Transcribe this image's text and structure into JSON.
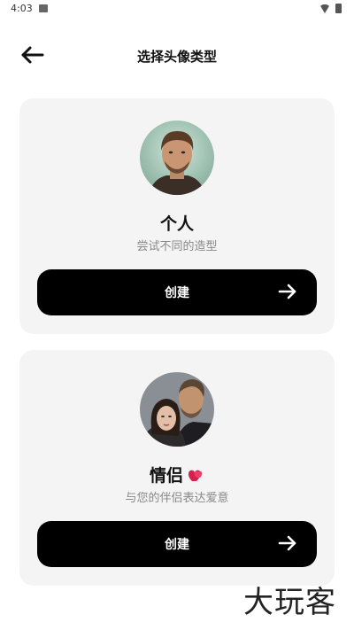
{
  "status_bar": {
    "time": "4:03"
  },
  "header": {
    "title": "选择头像类型",
    "back_icon": "arrow-left-icon"
  },
  "cards": [
    {
      "title": "个人",
      "subtitle": "尝试不同的造型",
      "button_label": "创建",
      "button_icon": "arrow-right-icon",
      "avatar": "man-portrait"
    },
    {
      "title": "情侣",
      "title_emoji": "heart-emoji",
      "subtitle": "与您的伴侣表达爱意",
      "button_label": "创建",
      "button_icon": "arrow-right-icon",
      "avatar": "couple-portrait"
    }
  ],
  "watermark": "大玩客",
  "colors": {
    "card_bg": "#f4f4f4",
    "button_bg": "#000000",
    "subtitle": "#888888"
  }
}
